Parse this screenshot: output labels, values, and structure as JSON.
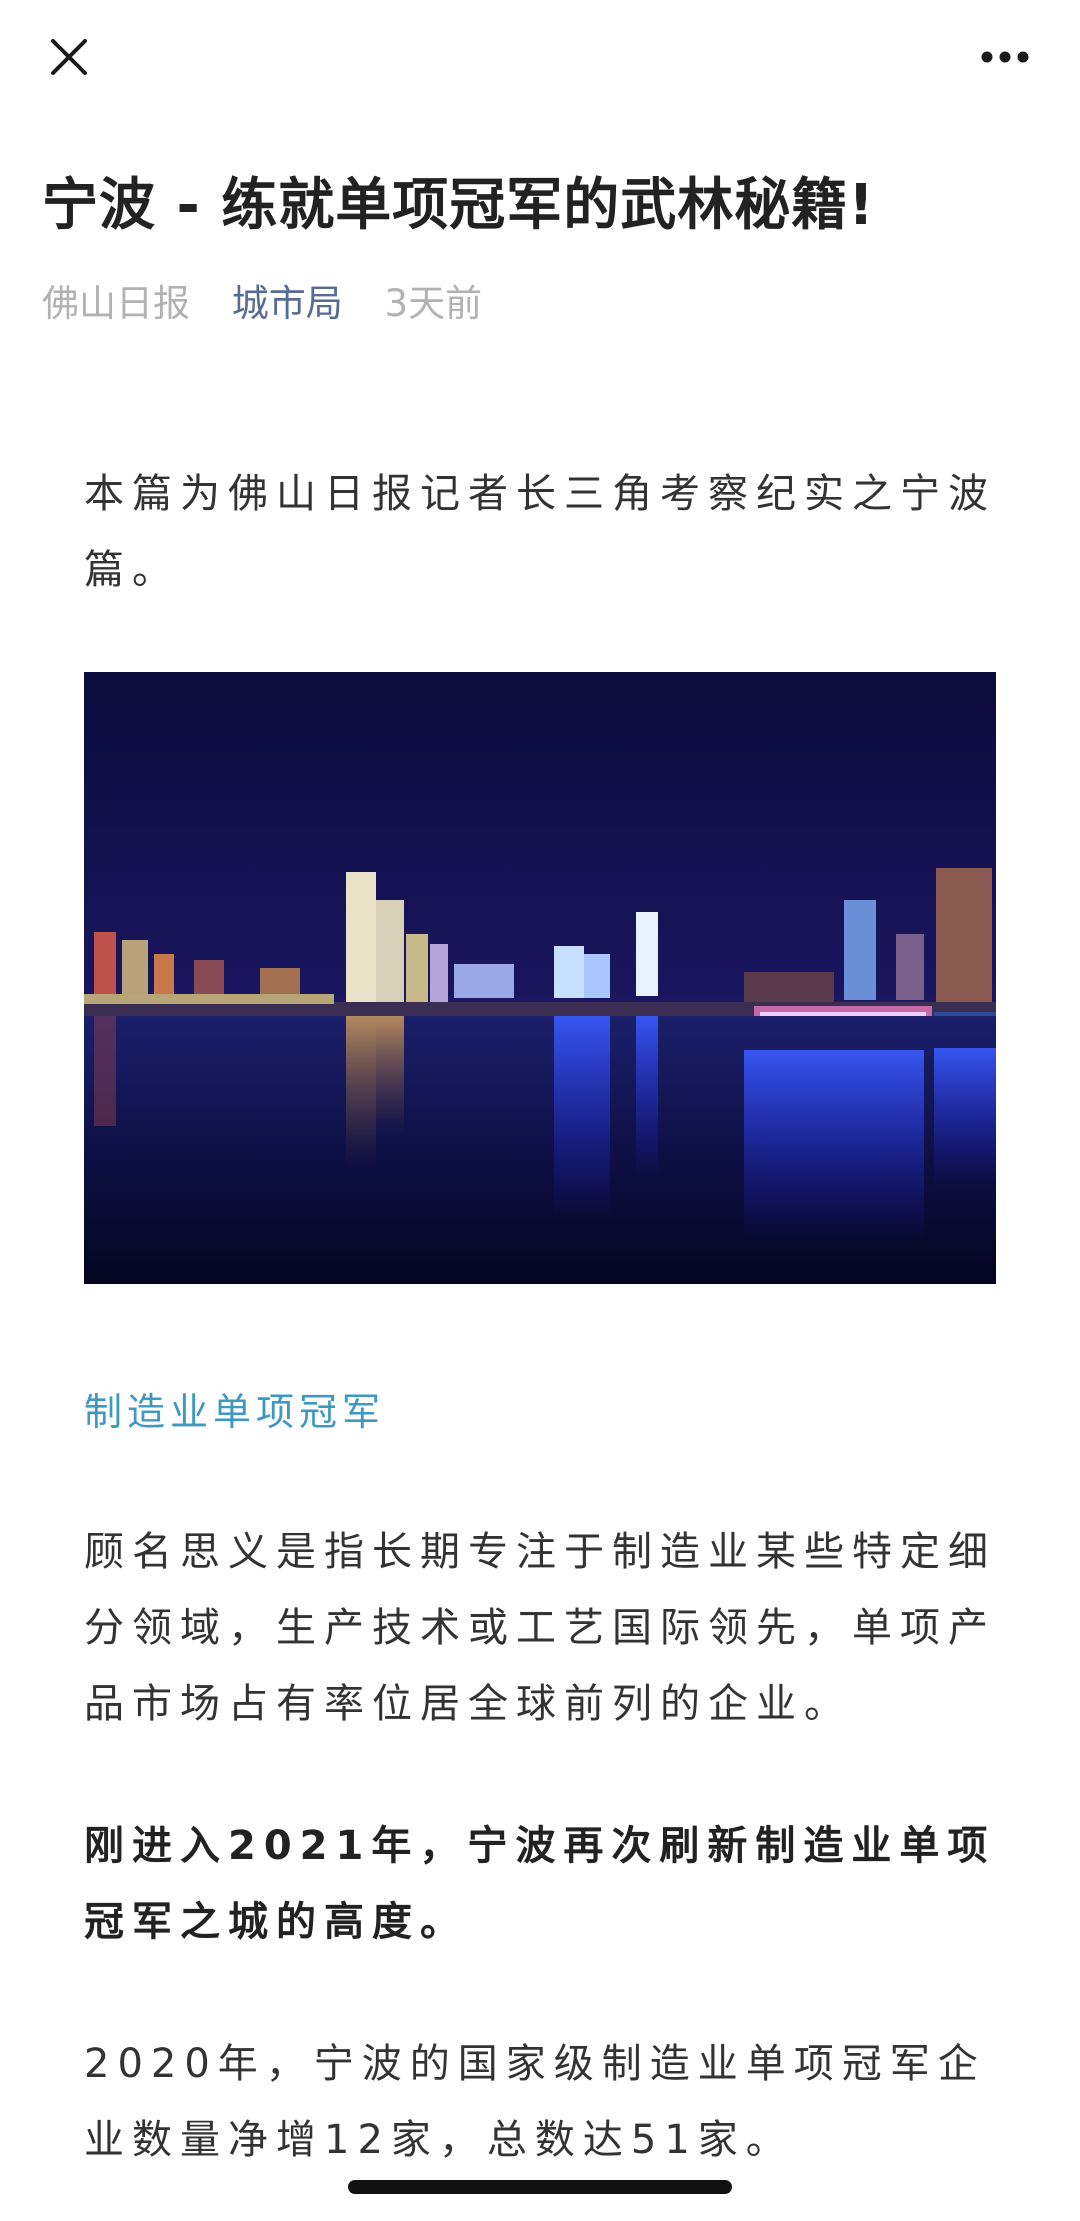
{
  "topbar": {
    "close_icon": "close-icon",
    "more_icon": "more-horizontal-icon"
  },
  "article": {
    "title": "宁波 - 练就单项冠军的武林秘籍!",
    "source": "佛山日报",
    "account": "城市局",
    "time": "3天前",
    "intro": "本篇为佛山日报记者长三角考察纪实之宁波篇。",
    "image_alt": "宁波城市夜景",
    "section_heading": "制造业单项冠军",
    "definition": "顾名思义是指长期专注于制造业某些特定细分领域，生产技术或工艺国际领先，单项产品市场占有率位居全球前列的企业。",
    "p_2021": "刚进入2021年，宁波再次刷新制造业单项冠军之城的高度。",
    "p_2020": "2020年，宁波的国家级制造业单项冠军企业数量净增12家，总数达51家。"
  },
  "colors": {
    "account_link": "#576b95",
    "meta_gray": "#b2b2b2",
    "section_heading": "#3f98c2",
    "text": "#333333"
  }
}
